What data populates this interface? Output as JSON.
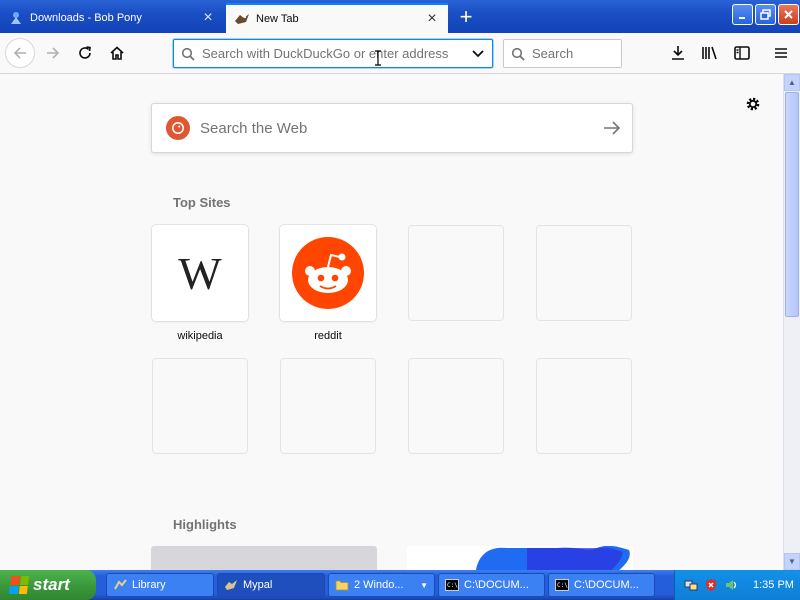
{
  "window": {
    "tabs": [
      {
        "label": "Downloads - Bob Pony",
        "active": false
      },
      {
        "label": "New Tab",
        "active": true
      }
    ],
    "new_tab_symbol": "+",
    "controls": {
      "minimize": "_",
      "restore": "❐",
      "close": "✕"
    }
  },
  "toolbar": {
    "url_placeholder": "Search with DuckDuckGo or enter address",
    "search_placeholder": "Search",
    "icons": [
      "back-icon",
      "forward-icon",
      "reload-icon",
      "home-icon",
      "download-icon",
      "library-icon",
      "sidebar-icon",
      "menu-icon"
    ]
  },
  "newtab": {
    "search_placeholder": "Search the Web",
    "top_sites_title": "Top Sites",
    "highlights_title": "Highlights",
    "top_sites": [
      {
        "label": "wikipedia",
        "icon": "wikipedia-icon"
      },
      {
        "label": "reddit",
        "icon": "reddit-icon"
      },
      {
        "label": "",
        "icon": ""
      },
      {
        "label": "",
        "icon": ""
      },
      {
        "label": "",
        "icon": ""
      },
      {
        "label": "",
        "icon": ""
      },
      {
        "label": "",
        "icon": ""
      },
      {
        "label": "",
        "icon": ""
      }
    ],
    "wikipedia_logo_text": "W"
  },
  "taskbar": {
    "start_label": "start",
    "tasks": [
      {
        "label": "Library",
        "icon": "library-icon"
      },
      {
        "label": "Mypal",
        "icon": "mypal-icon",
        "active": true
      },
      {
        "label": "2 Windo...",
        "icon": "folder-icon"
      },
      {
        "label": "C:\\DOCUM...",
        "icon": "console-icon"
      },
      {
        "label": "C:\\DOCUM...",
        "icon": "console-icon"
      }
    ],
    "clock": "1:35 PM"
  },
  "colors": {
    "accent": "#0a84ff",
    "xp_blue": "#245edb",
    "start_green": "#3c9a3c",
    "reddit": "#ff4500",
    "duckduckgo": "#de5833"
  }
}
